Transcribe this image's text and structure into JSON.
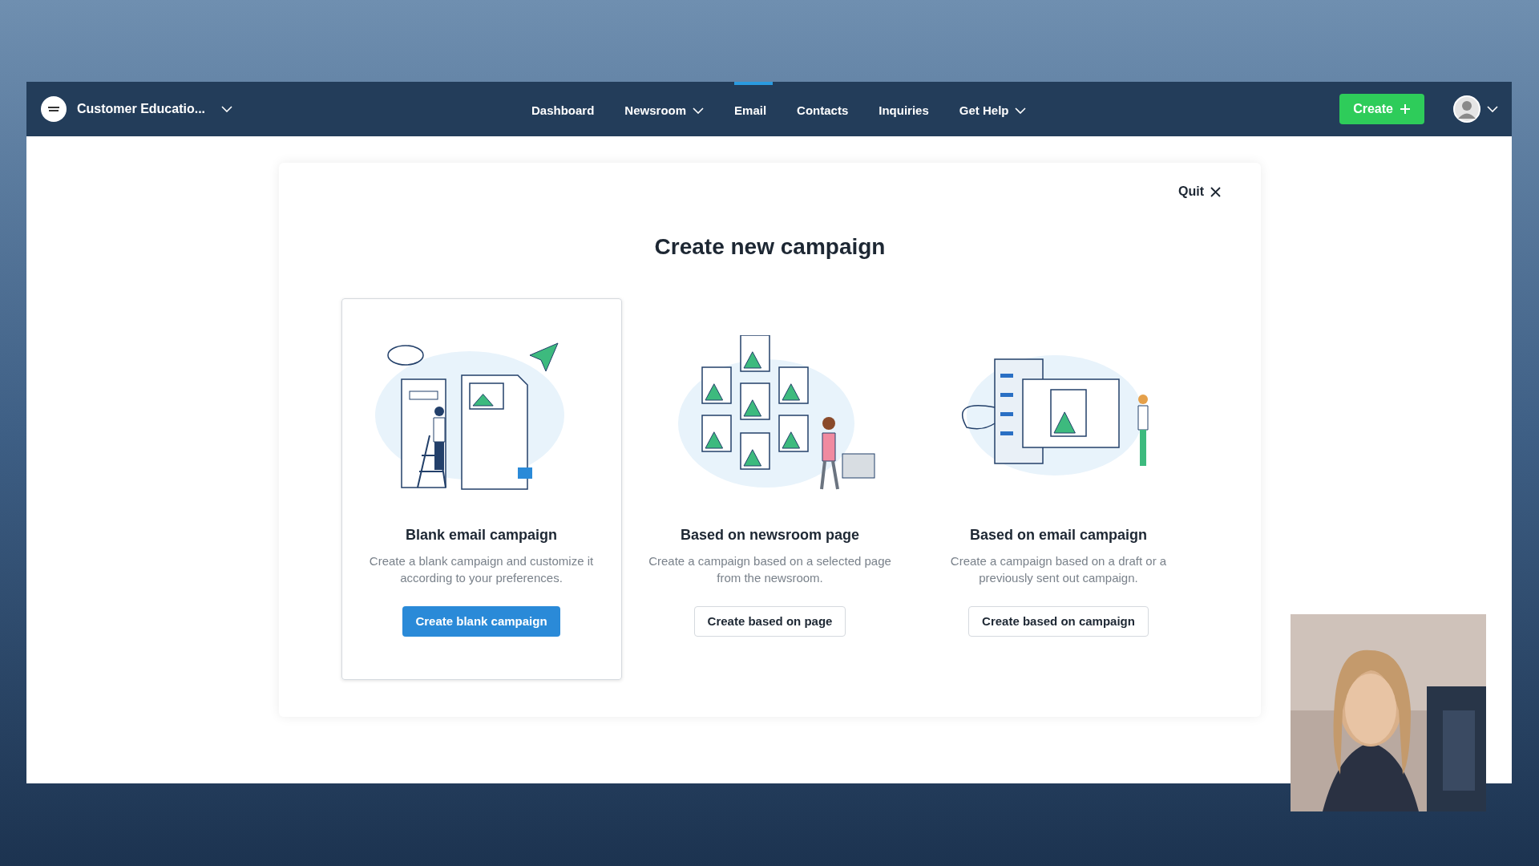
{
  "workspace": {
    "name": "Customer Educatio..."
  },
  "nav": [
    {
      "label": "Dashboard",
      "selected": false,
      "has_menu": false
    },
    {
      "label": "Newsroom",
      "selected": false,
      "has_menu": true
    },
    {
      "label": "Email",
      "selected": true,
      "has_menu": false
    },
    {
      "label": "Contacts",
      "selected": false,
      "has_menu": false
    },
    {
      "label": "Inquiries",
      "selected": false,
      "has_menu": false
    },
    {
      "label": "Get Help",
      "selected": false,
      "has_menu": true
    }
  ],
  "create_button": {
    "label": "Create"
  },
  "dialog": {
    "quit": "Quit",
    "title": "Create new campaign",
    "options": [
      {
        "kind": "blank",
        "title": "Blank email campaign",
        "description": "Create a blank campaign and customize it according to your preferences.",
        "button": "Create blank campaign",
        "selected": true
      },
      {
        "kind": "newsroom",
        "title": "Based on newsroom page",
        "description": "Create a campaign based on a selected page from the newsroom.",
        "button": "Create based on page",
        "selected": false
      },
      {
        "kind": "campaign",
        "title": "Based on email campaign",
        "description": "Create a campaign based on a draft or a previously sent out campaign.",
        "button": "Create based on campaign",
        "selected": false
      }
    ]
  }
}
